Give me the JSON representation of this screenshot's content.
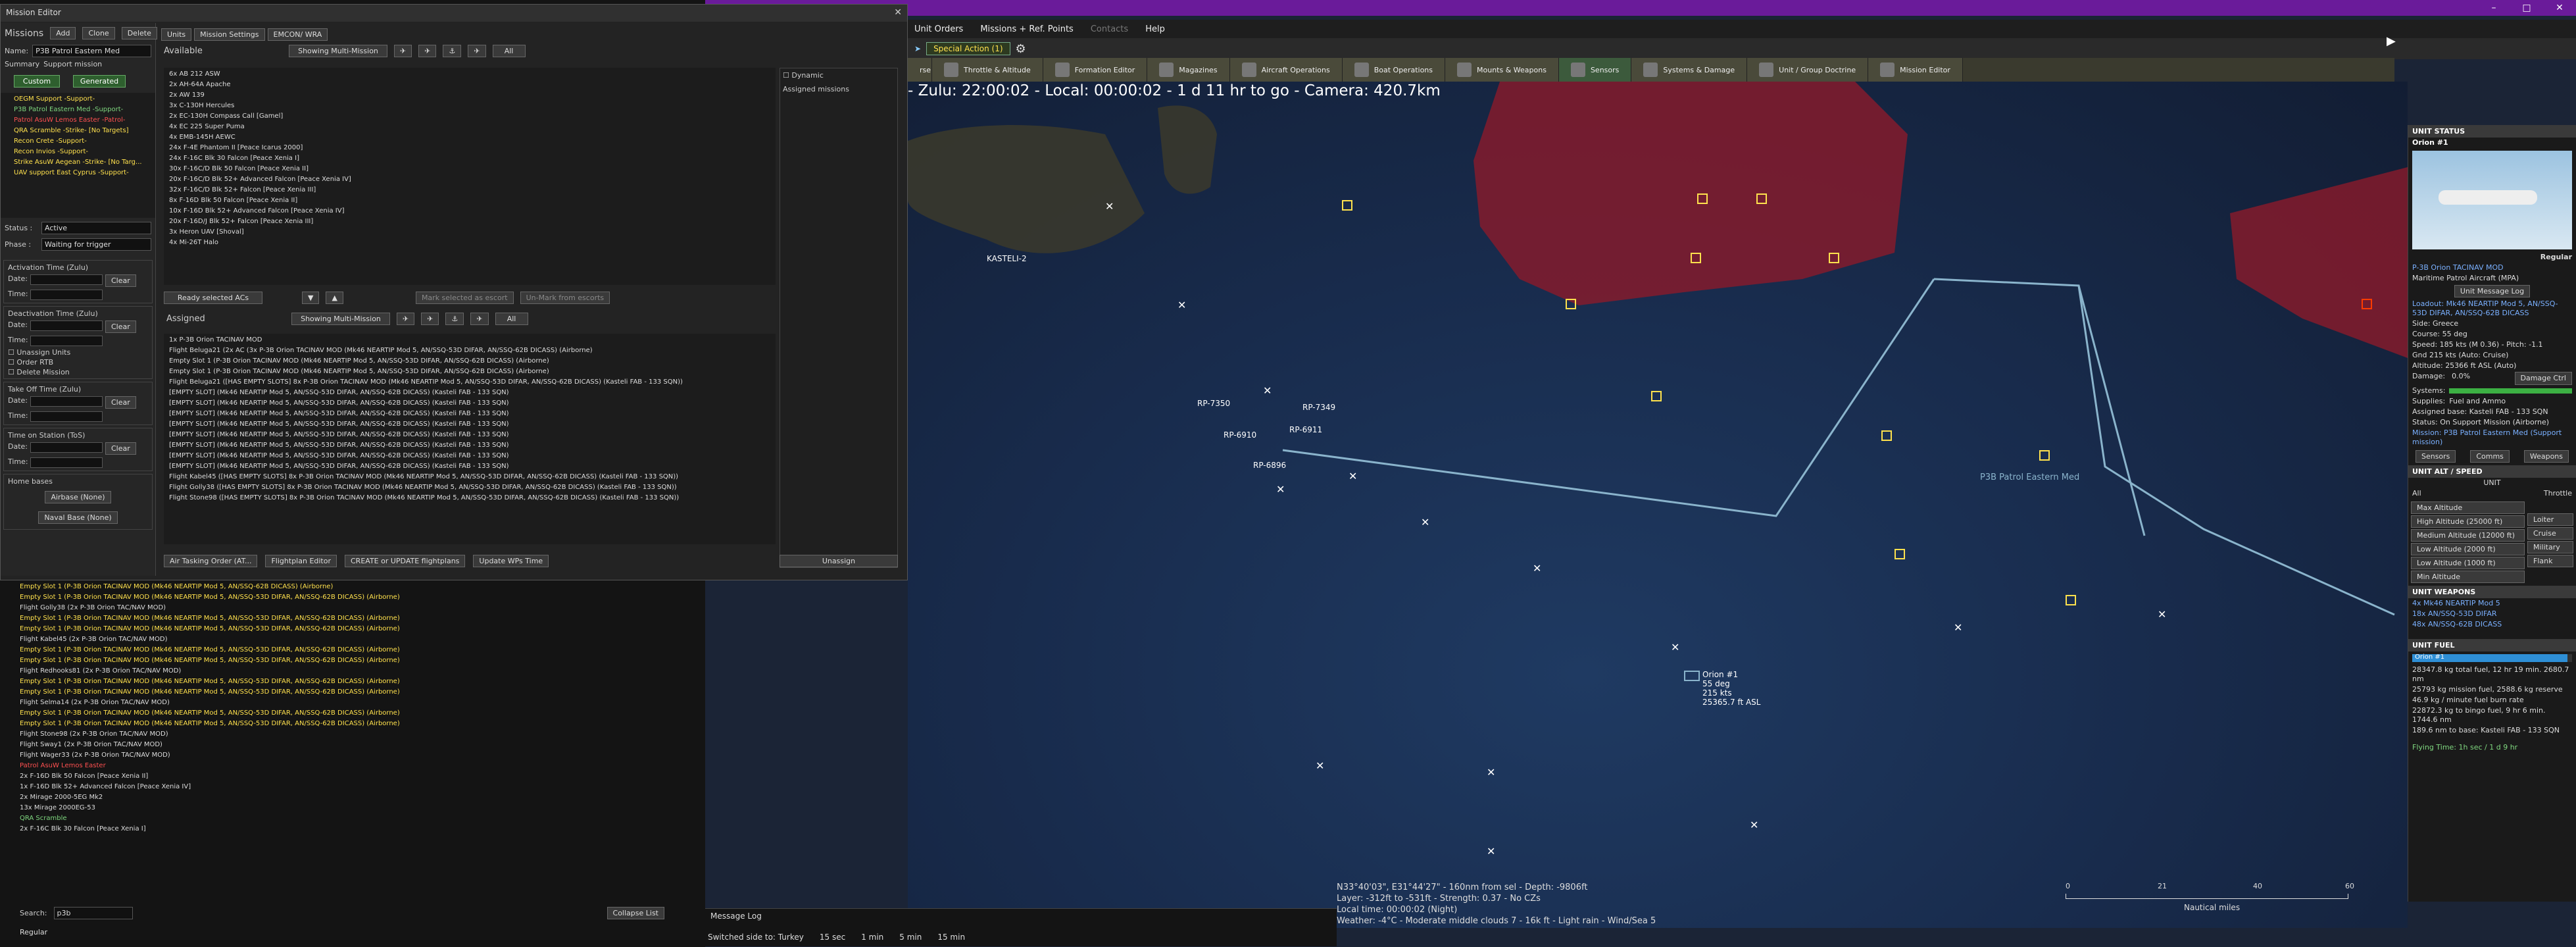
{
  "colors": {
    "accent": "#6a1b9a",
    "hostile": "#8b1a2a",
    "friendly": "#ffe14d",
    "patrol": "#8ab4cc"
  },
  "menubar": [
    "Unit Orders",
    "Missions + Ref. Points",
    "Contacts",
    "Help"
  ],
  "special_action": "Special Action (1)",
  "map_tabs": [
    {
      "label": "Throttle & Altitude",
      "icon": "throttle-icon"
    },
    {
      "label": "Formation Editor",
      "icon": "formation-icon"
    },
    {
      "label": "Magazines",
      "icon": "magazine-icon"
    },
    {
      "label": "Aircraft Operations",
      "icon": "aircraft-icon"
    },
    {
      "label": "Boat Operations",
      "icon": "boat-icon"
    },
    {
      "label": "Mounts & Weapons",
      "icon": "mounts-icon"
    },
    {
      "label": "Sensors",
      "icon": "sensor-icon"
    },
    {
      "label": "Systems & Damage",
      "icon": "systems-icon"
    },
    {
      "label": "Unit / Group Doctrine",
      "icon": "doctrine-icon"
    },
    {
      "label": "Mission Editor",
      "icon": "mission-icon"
    }
  ],
  "map_header": "- Zulu: 22:00:02 - Local: 00:00:02 - 1 d 11 hr to go - Camera: 420.7km",
  "map_status": [
    "N33°40'03\", E31°44'27\" - 160nm from sel - Depth: -9806ft",
    "Layer: -312ft to -531ft - Strength: 0.37 - No CZs",
    "Local time: 00:00:02 (Night)",
    "Weather: -4°C - Moderate middle clouds 7 - 16k ft - Light rain - Wind/Sea 5"
  ],
  "scale": {
    "ticks": [
      "0",
      "21",
      "40",
      "60"
    ],
    "unit": "Nautical miles"
  },
  "message_log": {
    "title": "Message Log",
    "side_text": "Switched side to: Turkey",
    "steps": [
      "15 sec",
      "1 min",
      "5 min",
      "15 min"
    ]
  },
  "map_labels": [
    {
      "text": "RP-7350"
    },
    {
      "text": "RP-7349"
    },
    {
      "text": "RP-6910"
    },
    {
      "text": "RP-6911"
    },
    {
      "text": "RP-6896"
    },
    {
      "text": "KASTELI-2"
    },
    {
      "text": "P3B Patrol Eastern Med"
    },
    {
      "text": "Orion #1"
    },
    {
      "text": "55 deg"
    },
    {
      "text": "215 kts"
    },
    {
      "text": "25365.7 ft ASL"
    }
  ],
  "editor": {
    "title": "Mission Editor",
    "missions_label": "Missions",
    "buttons": [
      "Add",
      "Clone",
      "Delete"
    ],
    "name_label": "Name:",
    "name_value": "P3B Patrol Eastern Med",
    "summary_label": "Summary",
    "summary_value": "Support mission",
    "filter_custom": "Custom",
    "filter_generated": "Generated",
    "missions": [
      {
        "text": "OEGM Support -Support-",
        "c": "y"
      },
      {
        "text": "P3B Patrol Eastern Med -Support-",
        "c": "g"
      },
      {
        "text": "Patrol AsuW Lemos Easter -Patrol-",
        "c": "r"
      },
      {
        "text": "QRA Scramble -Strike- [No Targets]",
        "c": "y"
      },
      {
        "text": "Recon Crete -Support-",
        "c": "y"
      },
      {
        "text": "Recon Invios -Support-",
        "c": "y"
      },
      {
        "text": "Strike AsuW Aegean -Strike- [No Targ...",
        "c": "y"
      },
      {
        "text": "UAV support East Cyprus -Support-",
        "c": "y"
      }
    ],
    "status_label": "Status :",
    "status_value": "Active",
    "phase_label": "Phase :",
    "phase_value": "Waiting for trigger",
    "activation_label": "Activation Time (Zulu)",
    "deactivation_label": "Deactivation Time (Zulu)",
    "takeoff_label": "Take Off Time (Zulu)",
    "tos_label": "Time on Station (ToS)",
    "date_label": "Date:",
    "time_label": "Time:",
    "clear": "Clear",
    "checks": [
      "Unassign Units",
      "Order RTB",
      "Delete Mission"
    ],
    "home_label": "Home bases",
    "airbase": "Airbase (None)",
    "navalbase": "Naval Base (None)",
    "tabs": [
      "Units",
      "Mission Settings",
      "EMCON/ WRA"
    ],
    "available_label": "Available",
    "showing": "Showing Multi-Mission",
    "all": "All",
    "available": [
      "6x AB 212 ASW",
      "2x AH-64A Apache",
      "2x AW 139",
      "3x C-130H Hercules",
      "2x EC-130H Compass Call [Gamel]",
      "4x EC 225 Super Puma",
      "4x EMB-145H AEWC",
      "24x F-4E Phantom II [Peace Icarus 2000]",
      "24x F-16C Blk 30 Falcon [Peace Xenia I]",
      "30x F-16C/D Blk 50 Falcon [Peace Xenia II]",
      "20x F-16C/D Blk 52+ Advanced Falcon [Peace Xenia IV]",
      "32x F-16C/D Blk 52+ Falcon [Peace Xenia III]",
      "8x F-16D Blk 50 Falcon [Peace Xenia II]",
      "10x F-16D Blk 52+ Advanced Falcon [Peace Xenia IV]",
      "20x F-16D/J Blk 52+ Falcon [Peace Xenia III]",
      "3x Heron UAV [Shoval]",
      "4x Mi-26T Halo"
    ],
    "dynamic": "Dynamic",
    "assigned_missions": "Assigned missions",
    "ready_btn": "Ready selected ACs",
    "mark_escort": "Mark selected as escort",
    "unmark_escort": "Un-Mark from escorts",
    "assigned_label": "Assigned",
    "assigned": [
      {
        "text": "1x P-3B Orion TACINAV MOD",
        "c": "w"
      },
      {
        "text": "Flight Beluga21 (2x AC (3x P-3B Orion TACINAV MOD (Mk46 NEARTIP Mod 5, AN/SSQ-53D DIFAR, AN/SSQ-62B DICASS) (Airborne)",
        "c": "w"
      },
      {
        "text": "Empty Slot 1 (P-3B Orion TACINAV MOD (Mk46 NEARTIP Mod 5, AN/SSQ-53D DIFAR, AN/SSQ-62B DICASS) (Airborne)",
        "c": "w"
      },
      {
        "text": "Empty Slot 1 (P-3B Orion TACINAV MOD (Mk46 NEARTIP Mod 5, AN/SSQ-53D DIFAR, AN/SSQ-62B DICASS) (Airborne)",
        "c": "w"
      },
      {
        "text": "Flight Beluga21 ([HAS EMPTY SLOTS] 8x P-3B Orion TACINAV MOD (Mk46 NEARTIP Mod 5, AN/SSQ-53D DIFAR, AN/SSQ-62B DICASS) (Kasteli FAB - 133 SQN))",
        "c": "w"
      },
      {
        "text": "[EMPTY SLOT] (Mk46 NEARTIP Mod 5, AN/SSQ-53D DIFAR, AN/SSQ-62B DICASS) (Kasteli FAB - 133 SQN)",
        "c": "w"
      },
      {
        "text": "[EMPTY SLOT] (Mk46 NEARTIP Mod 5, AN/SSQ-53D DIFAR, AN/SSQ-62B DICASS) (Kasteli FAB - 133 SQN)",
        "c": "w"
      },
      {
        "text": "[EMPTY SLOT] (Mk46 NEARTIP Mod 5, AN/SSQ-53D DIFAR, AN/SSQ-62B DICASS) (Kasteli FAB - 133 SQN)",
        "c": "w"
      },
      {
        "text": "[EMPTY SLOT] (Mk46 NEARTIP Mod 5, AN/SSQ-53D DIFAR, AN/SSQ-62B DICASS) (Kasteli FAB - 133 SQN)",
        "c": "w"
      },
      {
        "text": "[EMPTY SLOT] (Mk46 NEARTIP Mod 5, AN/SSQ-53D DIFAR, AN/SSQ-62B DICASS) (Kasteli FAB - 133 SQN)",
        "c": "w"
      },
      {
        "text": "[EMPTY SLOT] (Mk46 NEARTIP Mod 5, AN/SSQ-53D DIFAR, AN/SSQ-62B DICASS) (Kasteli FAB - 133 SQN)",
        "c": "w"
      },
      {
        "text": "[EMPTY SLOT] (Mk46 NEARTIP Mod 5, AN/SSQ-53D DIFAR, AN/SSQ-62B DICASS) (Kasteli FAB - 133 SQN)",
        "c": "w"
      },
      {
        "text": "[EMPTY SLOT] (Mk46 NEARTIP Mod 5, AN/SSQ-53D DIFAR, AN/SSQ-62B DICASS) (Kasteli FAB - 133 SQN)",
        "c": "w"
      },
      {
        "text": "Flight Kabel45 ([HAS EMPTY SLOTS] 8x P-3B Orion TACINAV MOD (Mk46 NEARTIP Mod 5, AN/SSQ-53D DIFAR, AN/SSQ-62B DICASS) (Kasteli FAB - 133 SQN))",
        "c": "w"
      },
      {
        "text": "Flight Golly38 ([HAS EMPTY SLOTS] 8x P-3B Orion TACINAV MOD (Mk46 NEARTIP Mod 5, AN/SSQ-53D DIFAR, AN/SSQ-62B DICASS) (Kasteli FAB - 133 SQN))",
        "c": "w"
      },
      {
        "text": "Flight Stone98 ([HAS EMPTY SLOTS] 8x P-3B Orion TACINAV MOD (Mk46 NEARTIP Mod 5, AN/SSQ-53D DIFAR, AN/SSQ-62B DICASS) (Kasteli FAB - 133 SQN))",
        "c": "w"
      }
    ],
    "unassign": "Unassign",
    "bottom_buttons": [
      "Air Tasking Order (AT...",
      "Flightplan Editor",
      "CREATE or UPDATE flightplans",
      "Update WPs Time"
    ]
  },
  "orbat": [
    {
      "text": "Empty Slot 1 (P-3B Orion TACINAV MOD (Mk46 NEARTIP Mod 5, AN/SSQ-62B DICASS) (Airborne)",
      "c": "y"
    },
    {
      "text": "Empty Slot 1 (P-3B Orion TACINAV MOD (Mk46 NEARTIP Mod 5, AN/SSQ-53D DIFAR, AN/SSQ-62B DICASS) (Airborne)",
      "c": "y"
    },
    {
      "text": "Flight Golly38 (2x P-3B Orion TAC/NAV MOD)",
      "c": "w"
    },
    {
      "text": "Empty Slot 1 (P-3B Orion TACINAV MOD (Mk46 NEARTIP Mod 5, AN/SSQ-53D DIFAR, AN/SSQ-62B DICASS) (Airborne)",
      "c": "y"
    },
    {
      "text": "Empty Slot 1 (P-3B Orion TACINAV MOD (Mk46 NEARTIP Mod 5, AN/SSQ-53D DIFAR, AN/SSQ-62B DICASS) (Airborne)",
      "c": "y"
    },
    {
      "text": "Flight Kabel45 (2x P-3B Orion TAC/NAV MOD)",
      "c": "w"
    },
    {
      "text": "Empty Slot 1 (P-3B Orion TACINAV MOD (Mk46 NEARTIP Mod 5, AN/SSQ-53D DIFAR, AN/SSQ-62B DICASS) (Airborne)",
      "c": "y"
    },
    {
      "text": "Empty Slot 1 (P-3B Orion TACINAV MOD (Mk46 NEARTIP Mod 5, AN/SSQ-53D DIFAR, AN/SSQ-62B DICASS) (Airborne)",
      "c": "y"
    },
    {
      "text": "Flight Redhooks81 (2x P-3B Orion TAC/NAV MOD)",
      "c": "w"
    },
    {
      "text": "Empty Slot 1 (P-3B Orion TACINAV MOD (Mk46 NEARTIP Mod 5, AN/SSQ-53D DIFAR, AN/SSQ-62B DICASS) (Airborne)",
      "c": "y"
    },
    {
      "text": "Empty Slot 1 (P-3B Orion TACINAV MOD (Mk46 NEARTIP Mod 5, AN/SSQ-53D DIFAR, AN/SSQ-62B DICASS) (Airborne)",
      "c": "y"
    },
    {
      "text": "Flight Selma14 (2x P-3B Orion TAC/NAV MOD)",
      "c": "w"
    },
    {
      "text": "Empty Slot 1 (P-3B Orion TACINAV MOD (Mk46 NEARTIP Mod 5, AN/SSQ-53D DIFAR, AN/SSQ-62B DICASS) (Airborne)",
      "c": "y"
    },
    {
      "text": "Empty Slot 1 (P-3B Orion TACINAV MOD (Mk46 NEARTIP Mod 5, AN/SSQ-53D DIFAR, AN/SSQ-62B DICASS) (Airborne)",
      "c": "y"
    },
    {
      "text": "Flight Stone98 (2x P-3B Orion TAC/NAV MOD)",
      "c": "w"
    },
    {
      "text": "Flight Sway1 (2x P-3B Orion TAC/NAV MOD)",
      "c": "w"
    },
    {
      "text": "Flight Wager33 (2x P-3B Orion TAC/NAV MOD)",
      "c": "w"
    },
    {
      "text": "Patrol AsuW Lemos Easter",
      "c": "r"
    },
    {
      "text": "2x F-16D Blk 50 Falcon [Peace Xenia II]",
      "c": "w"
    },
    {
      "text": "1x F-16D Blk 52+ Advanced Falcon [Peace Xenia IV]",
      "c": "w"
    },
    {
      "text": "2x Mirage 2000-5EG Mk2",
      "c": "w"
    },
    {
      "text": "13x Mirage 2000EG-53",
      "c": "w"
    },
    {
      "text": "QRA Scramble",
      "c": "g"
    },
    {
      "text": "2x F-16C Blk 30 Falcon [Peace Xenia I]",
      "c": "w"
    }
  ],
  "search_label": "Search:",
  "search_value": "p3b",
  "collapse": "Collapse List",
  "footer_left": "Regular",
  "unit_status": {
    "title": "UNIT STATUS",
    "name": "Orion #1",
    "proficiency": "Regular",
    "type": "P-3B Orion TACINAV MOD",
    "role": "Maritime Patrol Aircraft (MPA)",
    "log_btn": "Unit Message Log",
    "loadout": "Loadout: Mk46 NEARTIP Mod 5, AN/SSQ-53D DIFAR, AN/SSQ-62B DICASS",
    "side": "Side: Greece",
    "course": "Course: 55 deg",
    "speed": "Speed: 185 kts (M 0.36) - Pitch: -1.1",
    "gnd": "Gnd 215 kts (Auto: Cruise)",
    "alt": "Altitude: 25366 ft ASL (Auto)",
    "damage": "Damage:",
    "damage_val": "0.0%",
    "damage_ctrl": "Damage Ctrl",
    "systems": "Systems:",
    "supplies": "Supplies:",
    "supplies_val": "Fuel and Ammo",
    "base": "Assigned base: Kasteli FAB - 133 SQN",
    "on_support": "Status: On Support Mission (Airborne)",
    "mission": "Mission: P3B Patrol Eastern Med (Support mission)",
    "buttons": [
      "Sensors",
      "Comms",
      "Weapons"
    ],
    "alt_title": "UNIT ALT / SPEED",
    "unit": "UNIT",
    "all": "All",
    "throttle": "Throttle",
    "alt_btns": [
      "Max Altitude",
      "High Altitude (25000 ft)",
      "Medium Altitude (12000 ft)",
      "Low Altitude (2000 ft)",
      "Low Altitude (1000 ft)",
      "Min Altitude"
    ],
    "spd_btns": [
      "Loiter",
      "Cruise",
      "Military",
      "Flank"
    ],
    "weapons_title": "UNIT WEAPONS",
    "weapons": [
      "4x Mk46 NEARTIP Mod 5",
      "18x AN/SSQ-53D DIFAR",
      "48x AN/SSQ-62B DICASS"
    ],
    "fuel_title": "UNIT FUEL",
    "fuel_bar": "Orion #1",
    "fuel_frac": 0.97,
    "fuel": [
      "28347.8 kg total fuel, 12 hr 19 min. 2680.7 nm",
      "25793 kg mission fuel, 2588.6 kg reserve",
      "46.9 kg / minute fuel burn rate",
      "22872.3 kg to bingo fuel, 9 hr 6 min. 1744.6 nm",
      "189.6 nm to base: Kasteli FAB - 133 SQN"
    ],
    "flying_time": "Flying Time: 1h sec / 1 d 9 hr"
  }
}
